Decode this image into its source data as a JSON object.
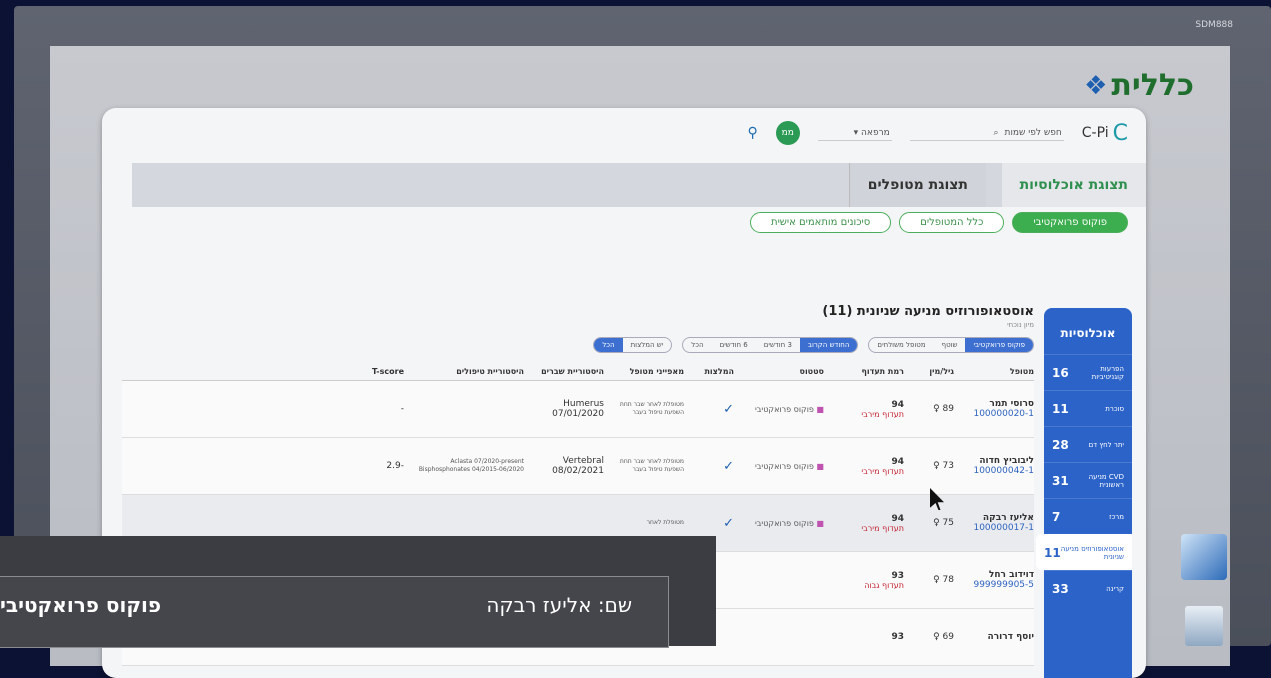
{
  "monitor_tag": "SDM888",
  "brand": "כללית",
  "app": {
    "logo": "C-Pi",
    "search_placeholder": "חפש לפי שמות",
    "region": "מרפאה",
    "avatar_text": "ממ",
    "tabs": [
      "תצוגת אוכלוסיות",
      "תצוגת מטופלים"
    ],
    "pills": [
      "פוקוס פרואקטיבי",
      "כלל המטופלים",
      "סיכונים מותאמים אישית"
    ]
  },
  "sidebar": {
    "title": "אוכלוסיות",
    "items": [
      {
        "label": "הפרעות קוגניטיביות",
        "count": "16"
      },
      {
        "label": "סוכרת",
        "count": "11"
      },
      {
        "label": "יתר לחץ דם",
        "count": "28"
      },
      {
        "label": "CVD מניעה ראשונית",
        "count": "31"
      },
      {
        "label": "מרכז",
        "count": "7"
      },
      {
        "label": "אוסטאופורוזיס מניעה שניונית",
        "count": "11"
      },
      {
        "label": "קרינה",
        "count": "33"
      }
    ]
  },
  "panel": {
    "title": "אוסטאופורוזיס מניעה שניונית (11)",
    "subtitle": "מיון נוכחי",
    "status_filter": [
      "פוקוס פרואקטיבי",
      "שוטף",
      "מטופל משולחים"
    ],
    "date_filter": [
      "החודש הקרוב",
      "3 חודשים",
      "6 חודשים",
      "הכל"
    ],
    "history_filter": [
      "יש המלצות",
      "הכל"
    ],
    "columns": [
      "מטופל",
      "גיל/מין",
      "רמת תעדוף",
      "סטטוס",
      "המלצות",
      "מאפייני מטופל",
      "היסטוריית שברים",
      "היסטוריית טיפולים",
      "T-score"
    ],
    "rows": [
      {
        "name": "סרוסי תמר",
        "id": "100000020-1",
        "age": "89",
        "prio": "94",
        "prio_label": "תעדוף מירבי",
        "status": "פוקוס פרואקטיבי",
        "traits": "מטופלת לאחר שבר תחת השפעת טיפול בעבר",
        "fracture": "Humerus 07/01/2020",
        "treat": "",
        "tscore": "-"
      },
      {
        "name": "ליבוביץ חדוה",
        "id": "100000042-1",
        "age": "73",
        "prio": "94",
        "prio_label": "תעדוף מירבי",
        "status": "פוקוס פרואקטיבי",
        "traits": "מטופלת לאחר שבר תחת השפעת טיפול בעבר",
        "fracture": "Vertebral 08/02/2021",
        "treat": "Aclasta 07/2020-present Bisphosphonates 04/2015-06/2020",
        "tscore": "-2.9"
      },
      {
        "name": "אליעז רבקה",
        "id": "100000017-1",
        "age": "75",
        "prio": "94",
        "prio_label": "תעדוף מירבי",
        "status": "פוקוס פרואקטיבי",
        "traits": "מטופלת לאחר",
        "fracture": "",
        "treat": "",
        "tscore": ""
      },
      {
        "name": "דוידוב רחל",
        "id": "999999905-5",
        "age": "78",
        "prio": "93",
        "prio_label": "תעדוף גבוה",
        "status": "",
        "traits": "",
        "fracture": "",
        "treat": "",
        "tscore": ""
      },
      {
        "name": "יוסף דרורה",
        "id": "",
        "age": "69",
        "prio": "93",
        "prio_label": "",
        "status": "",
        "traits": "",
        "fracture": "",
        "treat": "",
        "tscore": ""
      }
    ]
  },
  "overlay": {
    "name_line": "שם: אליעז רבקה",
    "focus": "פוקוס פרואקטיבי"
  }
}
